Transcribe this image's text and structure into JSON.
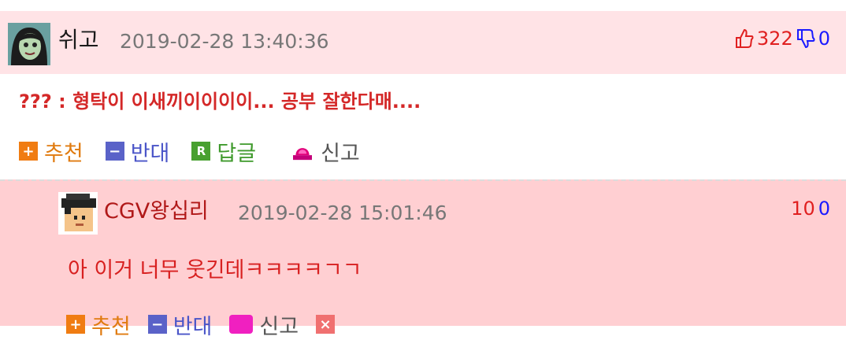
{
  "comment": {
    "author": "쉬고",
    "timestamp": "2019-02-28 13:40:36",
    "upvotes": "322",
    "downvotes": "0",
    "body": "??? : 형탁이 이새끼이이이이... 공부 잘한다매....",
    "actions": {
      "recommend": "추천",
      "oppose": "반대",
      "reply": "답글",
      "report": "신고"
    },
    "icons": {
      "recommend": "+",
      "oppose": "−",
      "reply": "R",
      "delete": "×"
    }
  },
  "reply": {
    "author": "CGV왕십리",
    "timestamp": "2019-02-28 15:01:46",
    "upvotes": "10",
    "downvotes": "0",
    "body": "아 이거 너무 웃긴데ㅋㅋㅋㅋㄱㄱ",
    "actions": {
      "recommend": "추천",
      "oppose": "반대",
      "report": "신고"
    }
  },
  "colors": {
    "header_bg": "#ffe3e6",
    "reply_bg": "#ffcfd2",
    "upvote": "#e02020",
    "downvote": "#1a1aff"
  }
}
